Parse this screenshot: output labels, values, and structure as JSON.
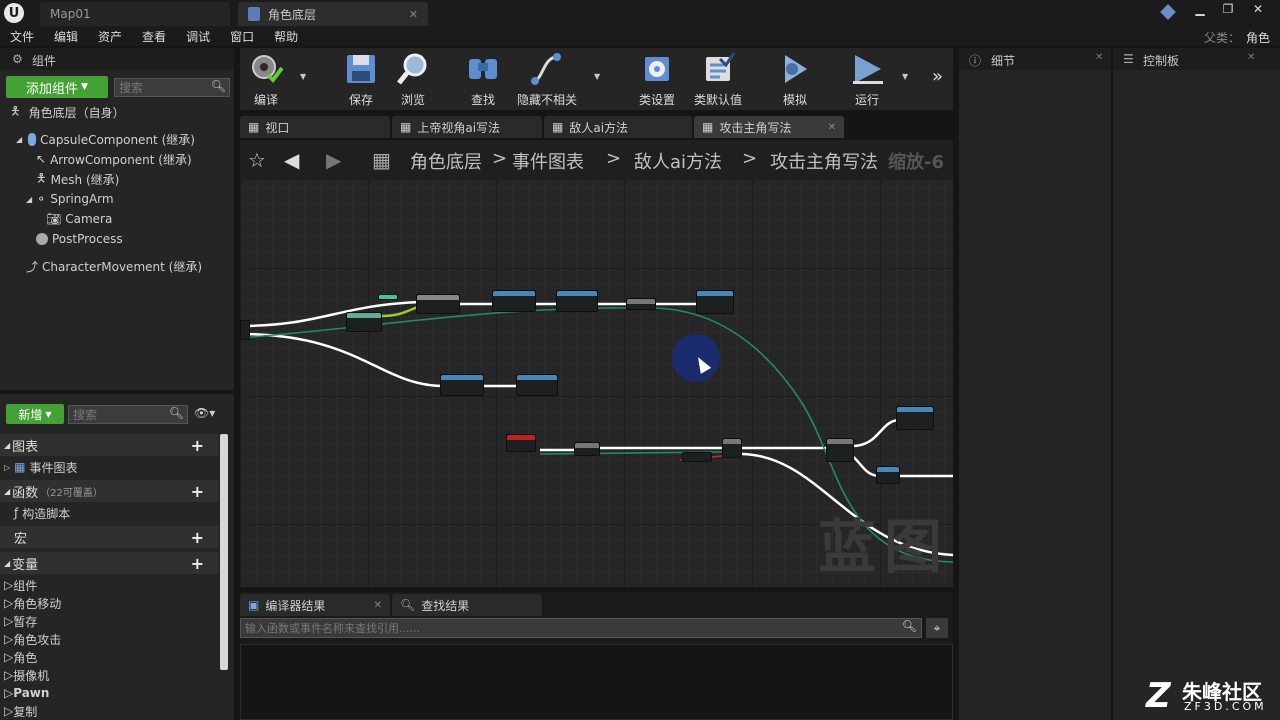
{
  "titlebar": {
    "tabs": [
      {
        "label": "Map01"
      },
      {
        "label": "角色底层"
      }
    ],
    "parent_class_label": "父类：",
    "parent_class_value": "角色"
  },
  "menu": [
    "文件",
    "编辑",
    "资产",
    "查看",
    "调试",
    "窗口",
    "帮助"
  ],
  "components_panel": {
    "tab_label": "组件",
    "add_button": "添加组件",
    "search_placeholder": "搜索",
    "root": "角色底层（自身）",
    "tree": [
      {
        "label": "CapsuleComponent (继承)"
      },
      {
        "label": "ArrowComponent (继承)"
      },
      {
        "label": "Mesh (继承)"
      },
      {
        "label": "SpringArm"
      },
      {
        "label": "Camera"
      },
      {
        "label": "PostProcess"
      },
      {
        "label": "CharacterMovement (继承)"
      }
    ]
  },
  "mybp_panel": {
    "new_button": "新增",
    "search_placeholder": "搜索",
    "sections": {
      "graphs": "图表",
      "event_graph": "事件图表",
      "functions": "函数",
      "functions_note": "（22可覆盖）",
      "construction": "构造脚本",
      "macros": "宏",
      "variables": "变量"
    },
    "var_categories": [
      "组件",
      "角色移动",
      "暂存",
      "角色攻击",
      "角色",
      "摄像机",
      "Pawn",
      "复制"
    ]
  },
  "toolbar": [
    {
      "label": "编译",
      "icon": "compile-icon"
    },
    {
      "label": "保存",
      "icon": "save-icon"
    },
    {
      "label": "浏览",
      "icon": "browse-icon"
    },
    {
      "label": "查找",
      "icon": "find-icon"
    },
    {
      "label": "隐藏不相关",
      "icon": "hide-unrelated-icon"
    },
    {
      "label": "类设置",
      "icon": "class-settings-icon"
    },
    {
      "label": "类默认值",
      "icon": "class-defaults-icon"
    },
    {
      "label": "模拟",
      "icon": "simulate-icon"
    },
    {
      "label": "运行",
      "icon": "play-icon"
    }
  ],
  "graph_tabs": [
    {
      "label": "视口"
    },
    {
      "label": "上帝视角ai写法"
    },
    {
      "label": "敌人ai方法"
    },
    {
      "label": "攻击主角写法"
    }
  ],
  "breadcrumb": {
    "items": [
      "角色底层",
      "事件图表",
      "敌人ai方法",
      "攻击主角写法"
    ],
    "zoom": "缩放-6"
  },
  "graph": {
    "watermark": "蓝图"
  },
  "details_panel": {
    "tab_label": "细节"
  },
  "palette_panel": {
    "tab_label": "控制板"
  },
  "bottom_panel": {
    "tabs": [
      {
        "label": "编译器结果"
      },
      {
        "label": "查找结果"
      }
    ],
    "find_placeholder": "输入函数或事件名称来查找引用......"
  },
  "logo": {
    "text": "朱峰社区",
    "sub": "ZF3D.COM"
  },
  "colors": {
    "accent_green": "#44a133",
    "graph_bg": "#262626",
    "exec_wire": "#ffffff",
    "data_wire": "#1e8c6a",
    "cursor_highlight": "#1a2b6e"
  }
}
